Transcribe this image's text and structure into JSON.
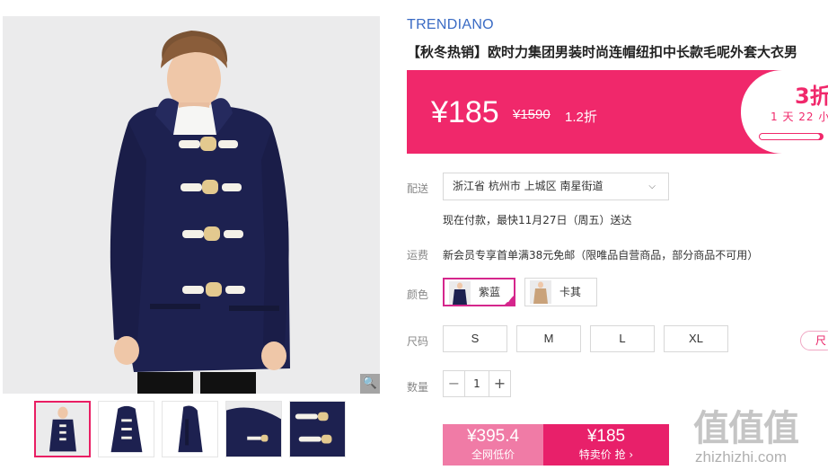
{
  "product": {
    "brand": "TRENDIANO",
    "title": "【秋冬热销】欧时力集团男装时尚连帽纽扣中长款毛呢外套大衣男"
  },
  "price": {
    "current": "¥185",
    "original": "¥1590",
    "discount": "1.2折"
  },
  "promo": {
    "headline": "3折",
    "countdown": "1 天 22 小",
    "progress_fraction": 0.95
  },
  "delivery": {
    "label": "配送",
    "region": "浙江省 杭州市 上城区 南星街道",
    "note": "现在付款，最快11月27日（周五）送达"
  },
  "shipping": {
    "label": "运费",
    "text": "新会员专享首单满38元免邮（限唯品自营商品，部分商品不可用）"
  },
  "colors": {
    "label": "颜色",
    "options": [
      {
        "name": "紫蓝",
        "selected": true
      },
      {
        "name": "卡其",
        "selected": false
      }
    ]
  },
  "sizes": {
    "label": "尺码",
    "options": [
      "S",
      "M",
      "L",
      "XL"
    ],
    "guide_label": "尺"
  },
  "quantity": {
    "label": "数量",
    "value": "1",
    "minus": "−",
    "plus": "+"
  },
  "buttons": {
    "low_price": "¥395.4",
    "low_label": "全网低价",
    "buy_price": "¥185",
    "buy_label": "特卖价 抢 ›"
  },
  "gallery": {
    "zoom_icon": "🔍",
    "thumbnail_count": 5
  },
  "watermark": {
    "glyphs": "值值值",
    "url": "zhizhizhi.com"
  },
  "theme": {
    "accent": "#f0286b",
    "navy": "#1d2150",
    "khaki": "#c9a27a"
  }
}
